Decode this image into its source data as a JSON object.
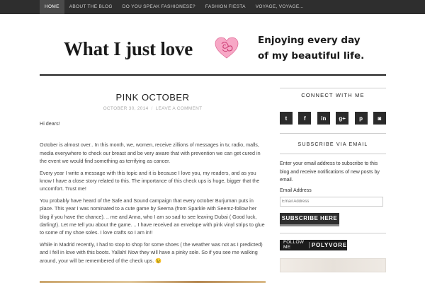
{
  "nav": {
    "items": [
      {
        "label": "HOME",
        "active": true
      },
      {
        "label": "ABOUT THE BLOG"
      },
      {
        "label": "DO YOU SPEAK FASHIONESE?"
      },
      {
        "label": "FASHION FIESTA"
      },
      {
        "label": "VOYAGE, VOYAGE..."
      }
    ]
  },
  "header": {
    "logo_text": "What I just love",
    "tagline_line1": "Enjoying every day",
    "tagline_line2": "of my beautiful life."
  },
  "post": {
    "title": "PINK OCTOBER",
    "date": "OCTOBER 30, 2014",
    "comment_link": "LEAVE A COMMENT",
    "greeting": "Hi dears!",
    "paragraphs": [
      "October is almost over.. In this month, we, women, receive zillions of messages in tv, radio, malls, media everywhere to check our breast and be very aware that with prevention we can get cured in the event we would find something as terrifying as cancer.",
      "Every year I write a message with this topic and it is because I love you, my readers, and as you know I have a close story related to this.  The importance of this check ups is huge, bigger that the uncomfort. Trust me!",
      "You probably have heard of the Safe and Sound campaign that every october Burjuman puts in place. This year I was nominated to a cute game by Seema (from Sparkle with Seemz-follow her blog if  you have the chance). .. me and Anna, who I am so sad to see leaving Dubai ( Good luck, darling!). Let me tell you about the game. .. I have received an envelope with pink vinyl strips to glue to some of my shoe soles. I love crafts so I am in!!",
      "While in Madrid recently, I had to stop to shop for some shoes ( the weather was not as I predicted) and I fell in love with this boots. Yallah! Now they will have a pinky sole. So if you see me walking around, your will be remembered of the check ups. 😉"
    ]
  },
  "sidebar": {
    "connect_heading": "CONNECT WITH ME",
    "social_icons": [
      {
        "name": "twitter-icon",
        "glyph": "t"
      },
      {
        "name": "facebook-icon",
        "glyph": "f"
      },
      {
        "name": "linkedin-icon",
        "glyph": "in"
      },
      {
        "name": "googleplus-icon",
        "glyph": "g+"
      },
      {
        "name": "pinterest-icon",
        "glyph": "p"
      },
      {
        "name": "instagram-icon",
        "glyph": "◙"
      }
    ],
    "subscribe_heading": "SUBSCRIBE VIA EMAIL",
    "subscribe_desc": "Enter your email address to subscribe to this blog and receive notifications of new posts by email.",
    "email_label": "Email Address",
    "email_placeholder": "Email Address",
    "subscribe_button": "SUBSCRIBE HERE",
    "polyvore_follow": "FOLLOW ME",
    "polyvore_name": "POLYVORE"
  },
  "colors": {
    "nav_bg": "#2e2e2e",
    "heart_pink": "#f28ab2",
    "button_bg": "#2e2e2e"
  }
}
